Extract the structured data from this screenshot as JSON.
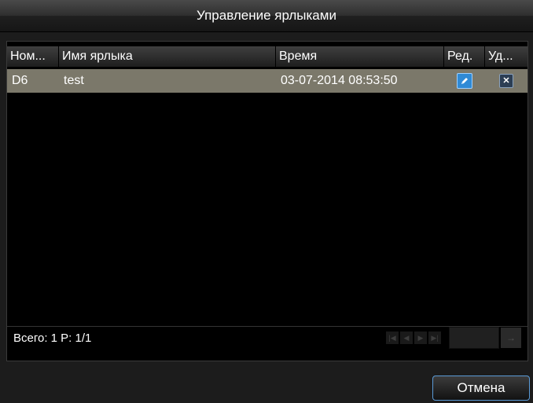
{
  "window": {
    "title": "Управление ярлыками"
  },
  "table": {
    "headers": [
      "Ном...",
      "Имя ярлыка",
      "Время",
      "Ред.",
      "Уд..."
    ],
    "rows": [
      {
        "num": "D6",
        "name": "test",
        "time": "03-07-2014 08:53:50",
        "edit_icon": "pencil-icon",
        "delete_icon": "close-icon"
      }
    ]
  },
  "status": {
    "text": "Всего: 1 P: 1/1"
  },
  "pager": {
    "icons": [
      "first-page-icon",
      "prev-page-icon",
      "next-page-icon",
      "last-page-icon",
      "go-arrow-icon"
    ],
    "page_input": ""
  },
  "buttons": {
    "cancel": "Отмена"
  },
  "colors": {
    "selected_row": "#7b786a",
    "accent": "#2f8ad6"
  }
}
